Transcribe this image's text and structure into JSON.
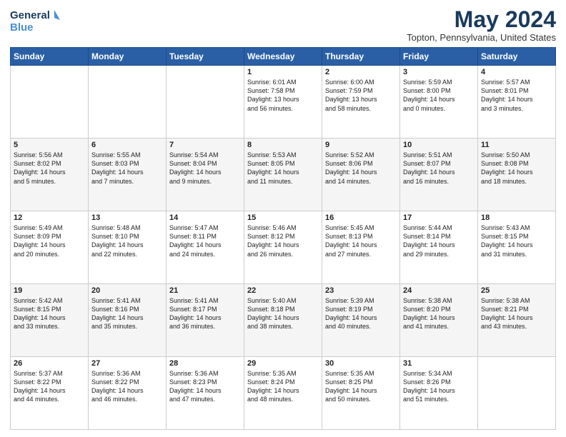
{
  "header": {
    "logo_line1": "General",
    "logo_line2": "Blue",
    "month_title": "May 2024",
    "location": "Topton, Pennsylvania, United States"
  },
  "days_of_week": [
    "Sunday",
    "Monday",
    "Tuesday",
    "Wednesday",
    "Thursday",
    "Friday",
    "Saturday"
  ],
  "weeks": [
    [
      {
        "day": "",
        "content": ""
      },
      {
        "day": "",
        "content": ""
      },
      {
        "day": "",
        "content": ""
      },
      {
        "day": "1",
        "content": "Sunrise: 6:01 AM\nSunset: 7:58 PM\nDaylight: 13 hours\nand 56 minutes."
      },
      {
        "day": "2",
        "content": "Sunrise: 6:00 AM\nSunset: 7:59 PM\nDaylight: 13 hours\nand 58 minutes."
      },
      {
        "day": "3",
        "content": "Sunrise: 5:59 AM\nSunset: 8:00 PM\nDaylight: 14 hours\nand 0 minutes."
      },
      {
        "day": "4",
        "content": "Sunrise: 5:57 AM\nSunset: 8:01 PM\nDaylight: 14 hours\nand 3 minutes."
      }
    ],
    [
      {
        "day": "5",
        "content": "Sunrise: 5:56 AM\nSunset: 8:02 PM\nDaylight: 14 hours\nand 5 minutes."
      },
      {
        "day": "6",
        "content": "Sunrise: 5:55 AM\nSunset: 8:03 PM\nDaylight: 14 hours\nand 7 minutes."
      },
      {
        "day": "7",
        "content": "Sunrise: 5:54 AM\nSunset: 8:04 PM\nDaylight: 14 hours\nand 9 minutes."
      },
      {
        "day": "8",
        "content": "Sunrise: 5:53 AM\nSunset: 8:05 PM\nDaylight: 14 hours\nand 11 minutes."
      },
      {
        "day": "9",
        "content": "Sunrise: 5:52 AM\nSunset: 8:06 PM\nDaylight: 14 hours\nand 14 minutes."
      },
      {
        "day": "10",
        "content": "Sunrise: 5:51 AM\nSunset: 8:07 PM\nDaylight: 14 hours\nand 16 minutes."
      },
      {
        "day": "11",
        "content": "Sunrise: 5:50 AM\nSunset: 8:08 PM\nDaylight: 14 hours\nand 18 minutes."
      }
    ],
    [
      {
        "day": "12",
        "content": "Sunrise: 5:49 AM\nSunset: 8:09 PM\nDaylight: 14 hours\nand 20 minutes."
      },
      {
        "day": "13",
        "content": "Sunrise: 5:48 AM\nSunset: 8:10 PM\nDaylight: 14 hours\nand 22 minutes."
      },
      {
        "day": "14",
        "content": "Sunrise: 5:47 AM\nSunset: 8:11 PM\nDaylight: 14 hours\nand 24 minutes."
      },
      {
        "day": "15",
        "content": "Sunrise: 5:46 AM\nSunset: 8:12 PM\nDaylight: 14 hours\nand 26 minutes."
      },
      {
        "day": "16",
        "content": "Sunrise: 5:45 AM\nSunset: 8:13 PM\nDaylight: 14 hours\nand 27 minutes."
      },
      {
        "day": "17",
        "content": "Sunrise: 5:44 AM\nSunset: 8:14 PM\nDaylight: 14 hours\nand 29 minutes."
      },
      {
        "day": "18",
        "content": "Sunrise: 5:43 AM\nSunset: 8:15 PM\nDaylight: 14 hours\nand 31 minutes."
      }
    ],
    [
      {
        "day": "19",
        "content": "Sunrise: 5:42 AM\nSunset: 8:15 PM\nDaylight: 14 hours\nand 33 minutes."
      },
      {
        "day": "20",
        "content": "Sunrise: 5:41 AM\nSunset: 8:16 PM\nDaylight: 14 hours\nand 35 minutes."
      },
      {
        "day": "21",
        "content": "Sunrise: 5:41 AM\nSunset: 8:17 PM\nDaylight: 14 hours\nand 36 minutes."
      },
      {
        "day": "22",
        "content": "Sunrise: 5:40 AM\nSunset: 8:18 PM\nDaylight: 14 hours\nand 38 minutes."
      },
      {
        "day": "23",
        "content": "Sunrise: 5:39 AM\nSunset: 8:19 PM\nDaylight: 14 hours\nand 40 minutes."
      },
      {
        "day": "24",
        "content": "Sunrise: 5:38 AM\nSunset: 8:20 PM\nDaylight: 14 hours\nand 41 minutes."
      },
      {
        "day": "25",
        "content": "Sunrise: 5:38 AM\nSunset: 8:21 PM\nDaylight: 14 hours\nand 43 minutes."
      }
    ],
    [
      {
        "day": "26",
        "content": "Sunrise: 5:37 AM\nSunset: 8:22 PM\nDaylight: 14 hours\nand 44 minutes."
      },
      {
        "day": "27",
        "content": "Sunrise: 5:36 AM\nSunset: 8:22 PM\nDaylight: 14 hours\nand 46 minutes."
      },
      {
        "day": "28",
        "content": "Sunrise: 5:36 AM\nSunset: 8:23 PM\nDaylight: 14 hours\nand 47 minutes."
      },
      {
        "day": "29",
        "content": "Sunrise: 5:35 AM\nSunset: 8:24 PM\nDaylight: 14 hours\nand 48 minutes."
      },
      {
        "day": "30",
        "content": "Sunrise: 5:35 AM\nSunset: 8:25 PM\nDaylight: 14 hours\nand 50 minutes."
      },
      {
        "day": "31",
        "content": "Sunrise: 5:34 AM\nSunset: 8:26 PM\nDaylight: 14 hours\nand 51 minutes."
      },
      {
        "day": "",
        "content": ""
      }
    ]
  ]
}
